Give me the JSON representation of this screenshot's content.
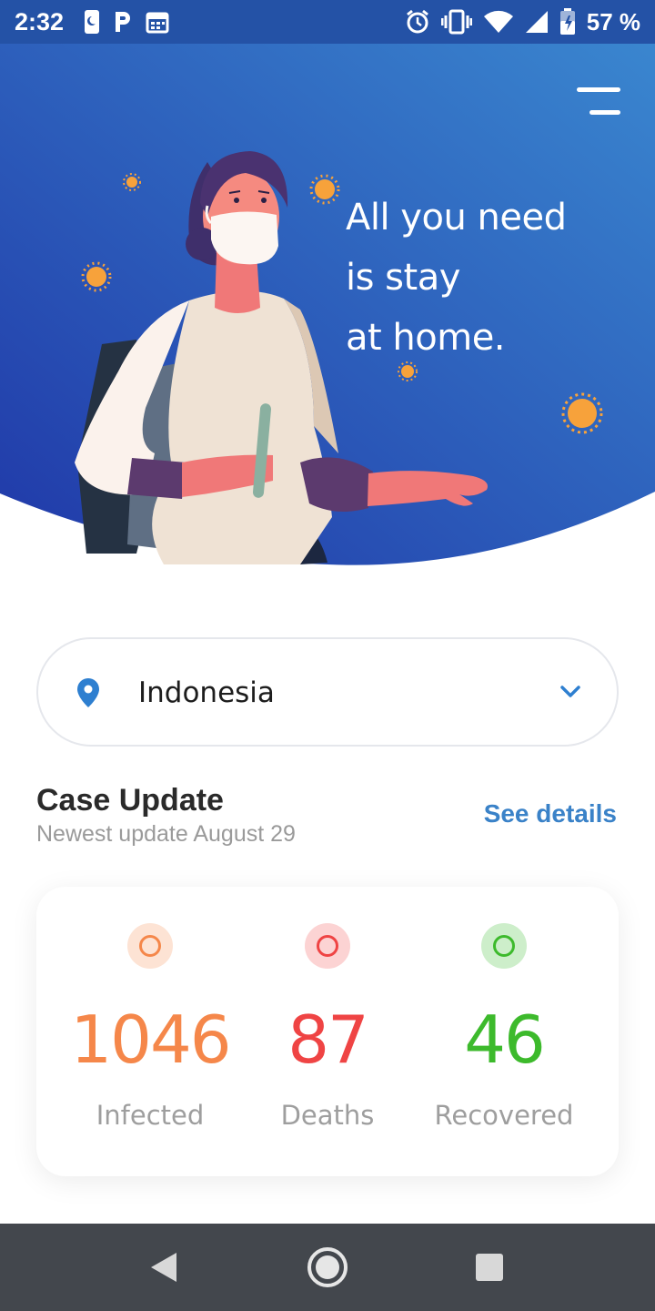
{
  "status_bar": {
    "time": "2:32",
    "battery": "57 %",
    "icons_left": [
      "phone-dnd-icon",
      "parking-icon",
      "calendar-icon"
    ],
    "icons_right": [
      "alarm-icon",
      "vibrate-icon",
      "wifi-icon",
      "signal-icon",
      "battery-icon"
    ]
  },
  "hero": {
    "title_lines": [
      "All you need",
      "is stay",
      "at home."
    ],
    "background_colors": [
      "#2038a8",
      "#3a86cf"
    ],
    "virus_color": "#f7a23b"
  },
  "location": {
    "selected": "Indonesia",
    "icon": "location-pin-icon",
    "accent": "#2e7fd0"
  },
  "case_update": {
    "title": "Case Update",
    "subtitle": "Newest update August 29",
    "see_details": "See details"
  },
  "stats": [
    {
      "label": "Infected",
      "value": "1046",
      "color": "#f5874a",
      "bg": "#fde3d4"
    },
    {
      "label": "Deaths",
      "value": "87",
      "color": "#ef4444",
      "bg": "#fcd3d3"
    },
    {
      "label": "Recovered",
      "value": "46",
      "color": "#3dba2c",
      "bg": "#cdeeca"
    }
  ],
  "nav_bar": {
    "buttons": [
      "back-icon",
      "home-icon",
      "recents-icon"
    ]
  }
}
